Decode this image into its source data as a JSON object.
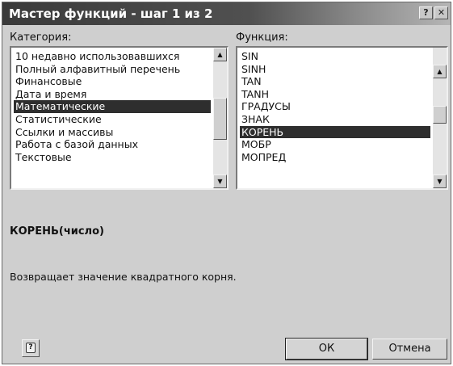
{
  "title": "Мастер функций - шаг 1 из 2",
  "titlebar_buttons": {
    "help": "?",
    "close": "✕"
  },
  "category": {
    "label": "Категория:",
    "items": [
      "10 недавно использовавшихся",
      "Полный алфавитный перечень",
      "Финансовые",
      "Дата и время",
      "Математические",
      "Статистические",
      "Ссылки и массивы",
      "Работа с базой данных",
      "Текстовые"
    ],
    "selected": "Математические"
  },
  "function": {
    "label": "Функция:",
    "items": [
      "SIN",
      "SINH",
      "TAN",
      "TANH",
      "ГРАДУСЫ",
      "ЗНАК",
      "КОРЕНЬ",
      "МОБР",
      "МОПРЕД"
    ],
    "selected": "КОРЕНЬ"
  },
  "syntax": "КОРЕНЬ(число)",
  "description": "Возвращает значение квадратного корня.",
  "buttons": {
    "help_icon": "?",
    "ok": "ОК",
    "cancel": "Отмена"
  },
  "icons": {
    "scroll_up": "scroll-up-arrow-icon",
    "scroll_down": "scroll-down-arrow-icon",
    "help": "question-icon"
  }
}
